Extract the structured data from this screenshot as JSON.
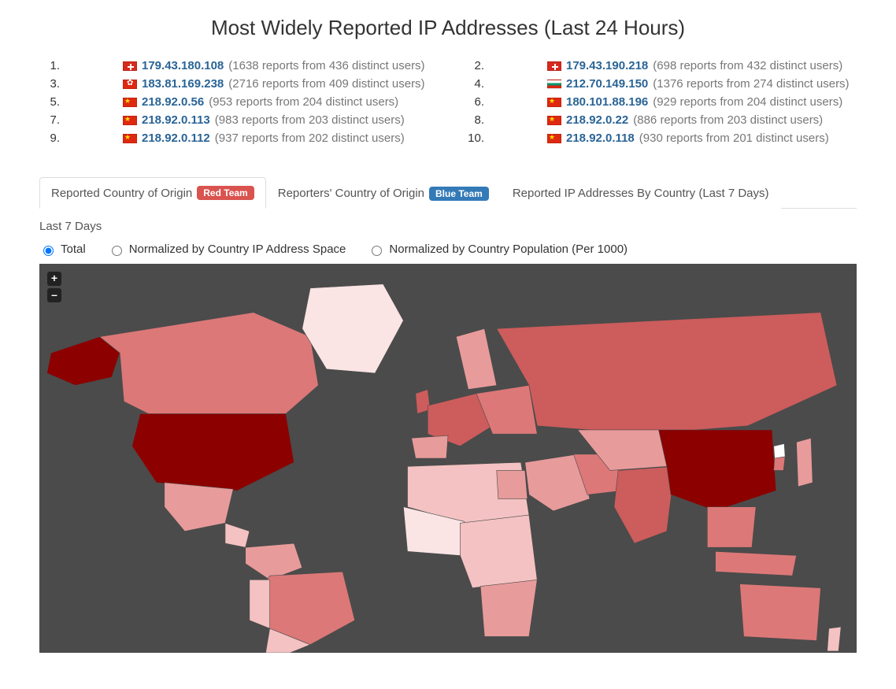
{
  "title": "Most Widely Reported IP Addresses (Last 24 Hours)",
  "ips": [
    {
      "n": "1.",
      "flag": "ch",
      "ip": "179.43.180.108",
      "meta": "(1638 reports from 436 distinct users)"
    },
    {
      "n": "2.",
      "flag": "ch",
      "ip": "179.43.190.218",
      "meta": "(698 reports from 432 distinct users)"
    },
    {
      "n": "3.",
      "flag": "hk",
      "ip": "183.81.169.238",
      "meta": "(2716 reports from 409 distinct users)"
    },
    {
      "n": "4.",
      "flag": "bg",
      "ip": "212.70.149.150",
      "meta": "(1376 reports from 274 distinct users)"
    },
    {
      "n": "5.",
      "flag": "cn",
      "ip": "218.92.0.56",
      "meta": "(953 reports from 204 distinct users)"
    },
    {
      "n": "6.",
      "flag": "cn",
      "ip": "180.101.88.196",
      "meta": "(929 reports from 204 distinct users)"
    },
    {
      "n": "7.",
      "flag": "cn",
      "ip": "218.92.0.113",
      "meta": "(983 reports from 203 distinct users)"
    },
    {
      "n": "8.",
      "flag": "cn",
      "ip": "218.92.0.22",
      "meta": "(886 reports from 203 distinct users)"
    },
    {
      "n": "9.",
      "flag": "cn",
      "ip": "218.92.0.112",
      "meta": "(937 reports from 202 distinct users)"
    },
    {
      "n": "10.",
      "flag": "cn",
      "ip": "218.92.0.118",
      "meta": "(930 reports from 201 distinct users)"
    }
  ],
  "tabs": {
    "t1_label": "Reported Country of Origin",
    "t1_badge": "Red Team",
    "t2_label": "Reporters' Country of Origin",
    "t2_badge": "Blue Team",
    "t3_label": "Reported IP Addresses By Country (Last 7 Days)"
  },
  "subheading": "Last 7 Days",
  "radios": {
    "r1": "Total",
    "r2": "Normalized by Country IP Address Space",
    "r3": "Normalized by Country Population (Per 1000)"
  },
  "zoom": {
    "in": "+",
    "out": "–"
  },
  "map_palette": {
    "bg": "#4b4b4b",
    "c0": "#ffffff",
    "c1": "#fbe4e4",
    "c2": "#f4c2c2",
    "c3": "#e89b9b",
    "c4": "#dd7878",
    "c5": "#cd5c5c",
    "c6": "#b83232",
    "c7": "#8c0000"
  }
}
